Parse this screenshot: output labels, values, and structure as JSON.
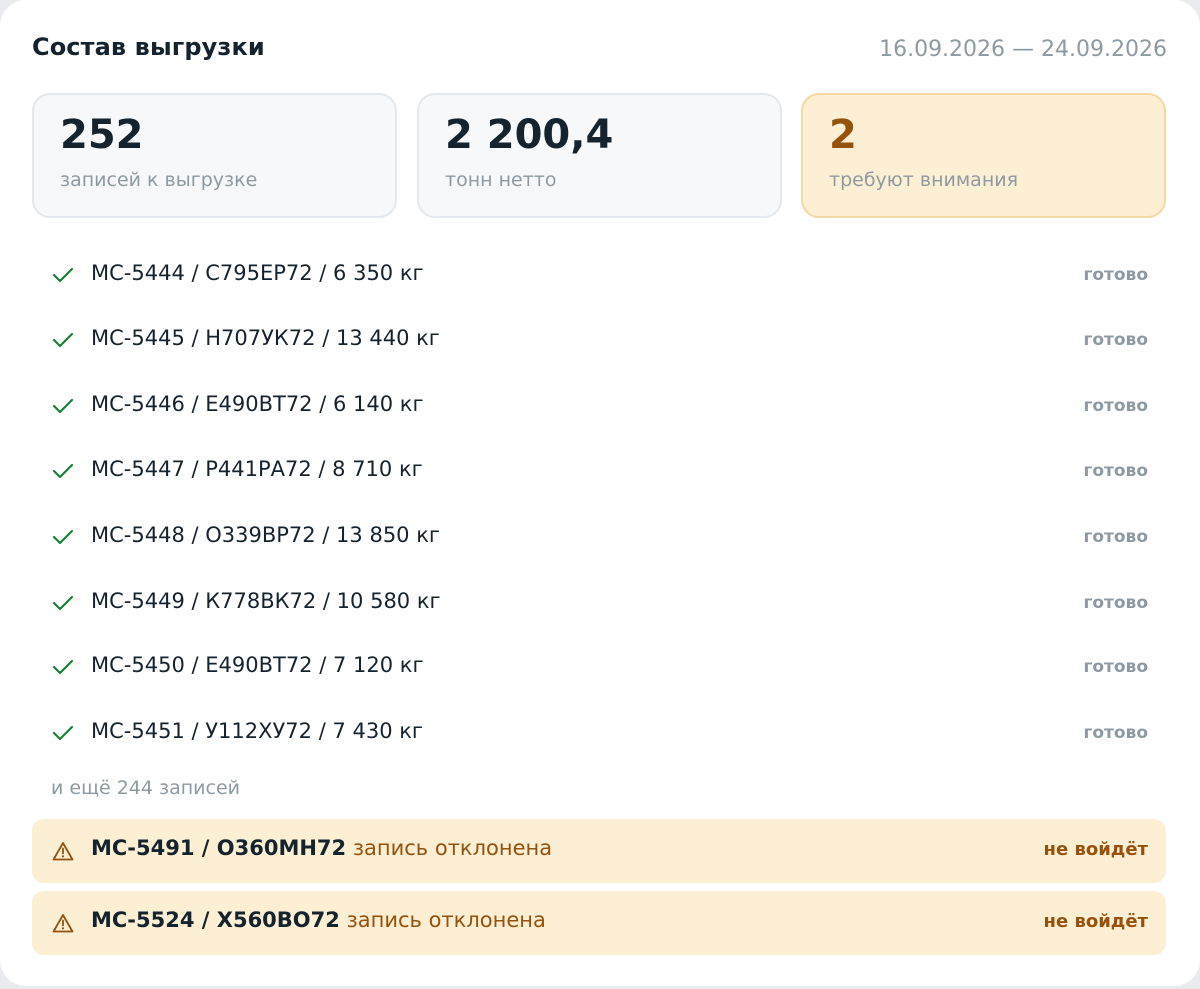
{
  "header": {
    "title": "Состав выгрузки",
    "period": "16.09.2026 — 24.09.2026"
  },
  "stats": [
    {
      "value": "252",
      "label": "записей к выгрузке"
    },
    {
      "value": "2 200,4",
      "label": "тонн нетто"
    },
    {
      "value": "2",
      "label": "требуют внимания"
    }
  ],
  "records": [
    {
      "text": "МС-5444 / С795ЕР72 / 6 350 кг",
      "status": "готово"
    },
    {
      "text": "МС-5445 / Н707УК72 / 13 440 кг",
      "status": "готово"
    },
    {
      "text": "МС-5446 / Е490ВТ72 / 6 140 кг",
      "status": "готово"
    },
    {
      "text": "МС-5447 / Р441РА72 / 8 710 кг",
      "status": "готово"
    },
    {
      "text": "МС-5448 / О339ВР72 / 13 850 кг",
      "status": "готово"
    },
    {
      "text": "МС-5449 / К778ВК72 / 10 580 кг",
      "status": "готово"
    },
    {
      "text": "МС-5450 / Е490ВТ72 / 7 120 кг",
      "status": "готово"
    },
    {
      "text": "МС-5451 / У112ХУ72 / 7 430 кг",
      "status": "готово"
    }
  ],
  "more_records": "и ещё 244 записей",
  "alerts": [
    {
      "id": "МС-5491 / О360МН72",
      "reason": "запись отклонена",
      "status": "не войдёт"
    },
    {
      "id": "МС-5524 / Х560ВО72",
      "reason": "запись отклонена",
      "status": "не войдёт"
    }
  ],
  "icons": {
    "ready": "check-icon",
    "warning": "warning-triangle-icon"
  },
  "colors": {
    "ok": "#1a7f37",
    "warning_bg": "#fdefd3",
    "warning_text": "#96520b",
    "muted": "#8e9aa2"
  }
}
